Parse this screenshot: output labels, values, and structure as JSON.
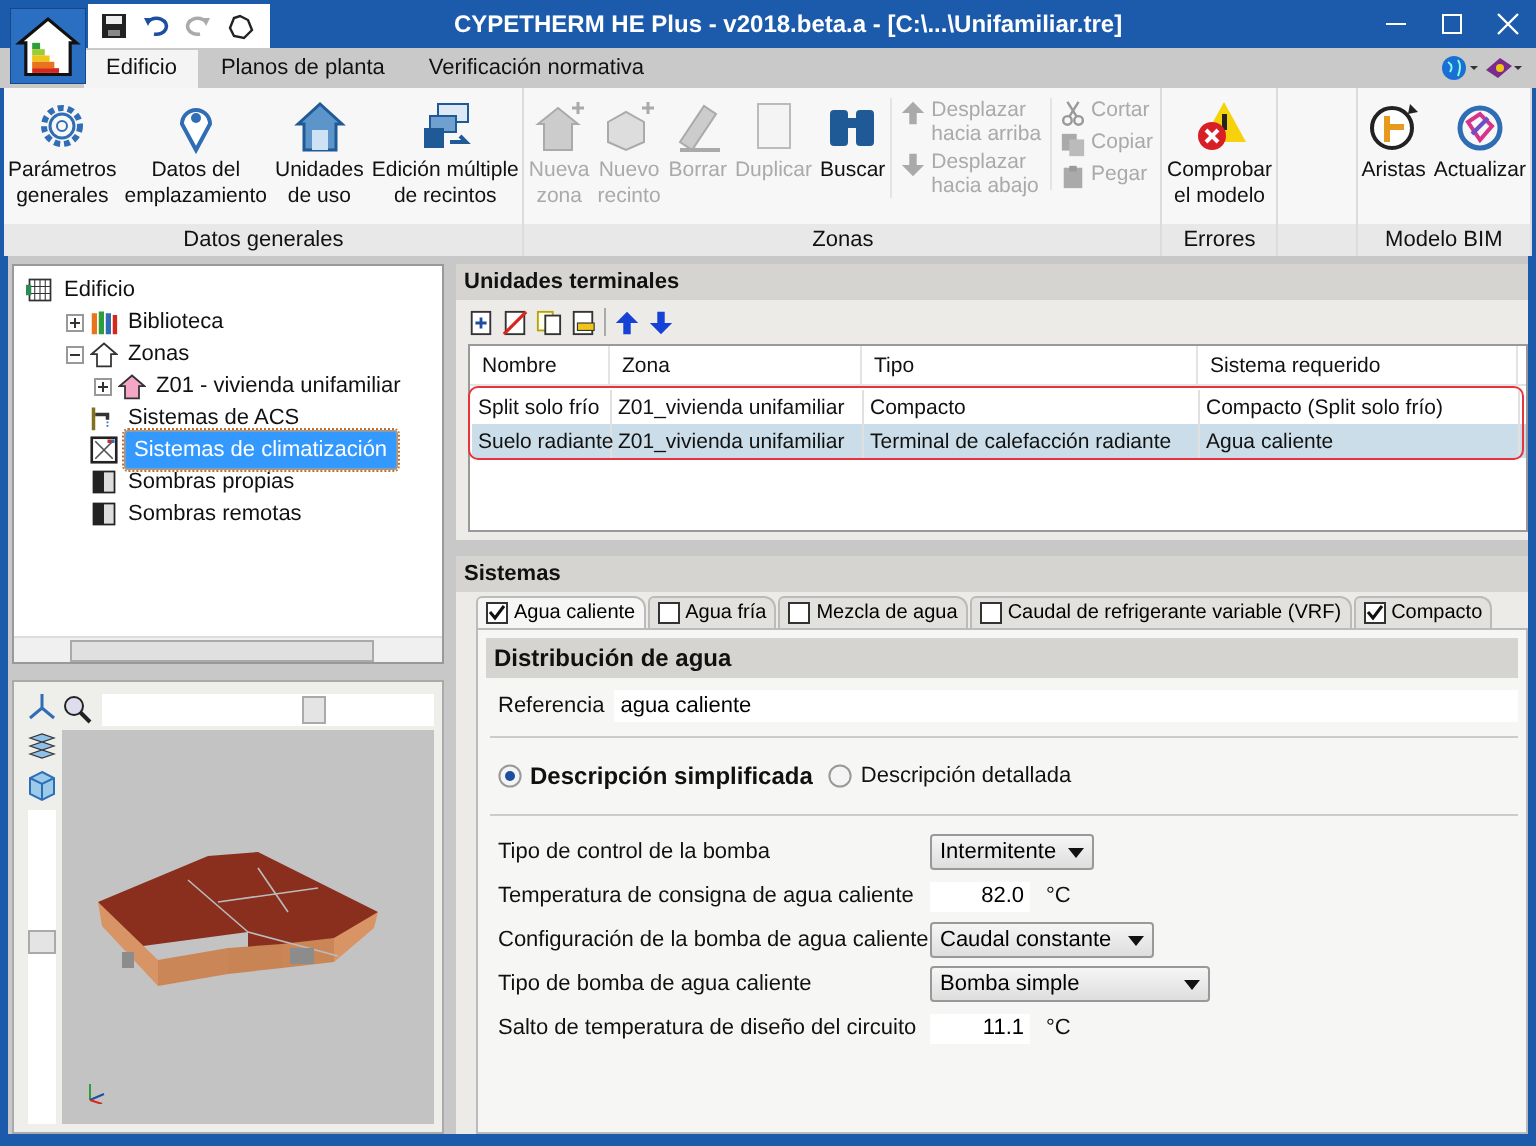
{
  "window": {
    "title": "CYPETHERM HE Plus - v2018.beta.a - [C:\\...\\Unifamiliar.tre]"
  },
  "ribbon_tabs": [
    {
      "label": "Edificio",
      "selected": true
    },
    {
      "label": "Planos de planta",
      "selected": false
    },
    {
      "label": "Verificación normativa",
      "selected": false
    }
  ],
  "ribbon_groups": [
    {
      "label": "Datos generales",
      "items": [
        {
          "kind": "large",
          "label": "Parámetros\ngenerales",
          "disabled": false
        },
        {
          "kind": "large",
          "label": "Datos del\nemplazamiento",
          "disabled": false
        },
        {
          "kind": "large",
          "label": "Unidades\nde uso",
          "disabled": false
        },
        {
          "kind": "large",
          "label": "Edición múltiple\nde recintos",
          "disabled": false
        }
      ]
    },
    {
      "label": "Zonas",
      "items": [
        {
          "kind": "large",
          "label": "Nueva\nzona",
          "disabled": true
        },
        {
          "kind": "large",
          "label": "Nuevo\nrecinto",
          "disabled": true
        },
        {
          "kind": "large",
          "label": "Borrar",
          "disabled": true
        },
        {
          "kind": "large",
          "label": "Duplicar",
          "disabled": true
        },
        {
          "kind": "large",
          "label": "Buscar",
          "disabled": false
        },
        {
          "kind": "stack",
          "items": [
            {
              "label": "Desplazar\nhacia arriba",
              "disabled": true
            },
            {
              "label": "Desplazar\nhacia abajo",
              "disabled": true
            }
          ]
        },
        {
          "kind": "stack",
          "items": [
            {
              "label": "Cortar",
              "disabled": true
            },
            {
              "label": "Copiar",
              "disabled": true
            },
            {
              "label": "Pegar",
              "disabled": true
            }
          ]
        }
      ]
    },
    {
      "label": "Errores",
      "items": [
        {
          "kind": "large",
          "label": "Comprobar\nel modelo",
          "disabled": false
        }
      ]
    },
    {
      "label": "Modelo BIM",
      "items": [
        {
          "kind": "large",
          "label": "Aristas",
          "disabled": false
        },
        {
          "kind": "large",
          "label": "Actualizar",
          "disabled": false
        }
      ]
    }
  ],
  "tree": {
    "items": [
      {
        "kind": "building",
        "label": "Edificio",
        "selected": false,
        "children": [
          {
            "kind": "library",
            "label": "Biblioteca",
            "selected": false,
            "expanded": false
          },
          {
            "kind": "zones",
            "label": "Zonas",
            "selected": false,
            "expanded": true,
            "children": [
              {
                "kind": "zone",
                "label": "Z01 - vivienda unifamiliar",
                "selected": false,
                "expanded": false
              }
            ]
          },
          {
            "kind": "dhw",
            "label": "Sistemas de ACS",
            "selected": false
          },
          {
            "kind": "hvac",
            "label": "Sistemas de climatización",
            "selected": true
          },
          {
            "kind": "shade",
            "label": "Sombras propias",
            "selected": false
          },
          {
            "kind": "shade",
            "label": "Sombras remotas",
            "selected": false
          }
        ]
      }
    ]
  },
  "terminal_units": {
    "title": "Unidades terminales",
    "columns": [
      "Nombre",
      "Zona",
      "Tipo",
      "Sistema requerido"
    ],
    "rows": [
      {
        "cells": [
          "Split solo frío",
          "Z01_vivienda unifamiliar",
          "Compacto",
          "Compacto (Split solo frío)"
        ],
        "selected": false
      },
      {
        "cells": [
          "Suelo radiante",
          "Z01_vivienda unifamiliar",
          "Terminal de calefacción radiante",
          "Agua caliente"
        ],
        "selected": true
      }
    ]
  },
  "systems": {
    "title": "Sistemas",
    "tabs": [
      {
        "label": "Agua caliente",
        "checked": true,
        "selected": true
      },
      {
        "label": "Agua fría",
        "checked": false,
        "selected": false
      },
      {
        "label": "Mezcla de agua",
        "checked": false,
        "selected": false
      },
      {
        "label": "Caudal de refrigerante variable (VRF)",
        "checked": false,
        "selected": false
      },
      {
        "label": "Compacto",
        "checked": true,
        "selected": false
      }
    ],
    "section": "Distribución de agua",
    "reference": {
      "label": "Referencia",
      "value": "agua caliente"
    },
    "modes": [
      {
        "label": "Descripción simplificada",
        "selected": true
      },
      {
        "label": "Descripción detallada",
        "selected": false
      }
    ],
    "fields": [
      {
        "kind": "select",
        "label": "Tipo de control de la bomba",
        "value": "Intermitente"
      },
      {
        "kind": "number",
        "label": "Temperatura de consigna de agua caliente",
        "value": "82.0",
        "unit": "°C"
      },
      {
        "kind": "select",
        "label": "Configuración de la bomba de agua caliente",
        "value": "Caudal constante"
      },
      {
        "kind": "select",
        "label": "Tipo de bomba de agua caliente",
        "value": "Bomba simple"
      },
      {
        "kind": "number",
        "label": "Salto de temperatura de diseño del circuito",
        "value": "11.1",
        "unit": "°C"
      }
    ]
  }
}
